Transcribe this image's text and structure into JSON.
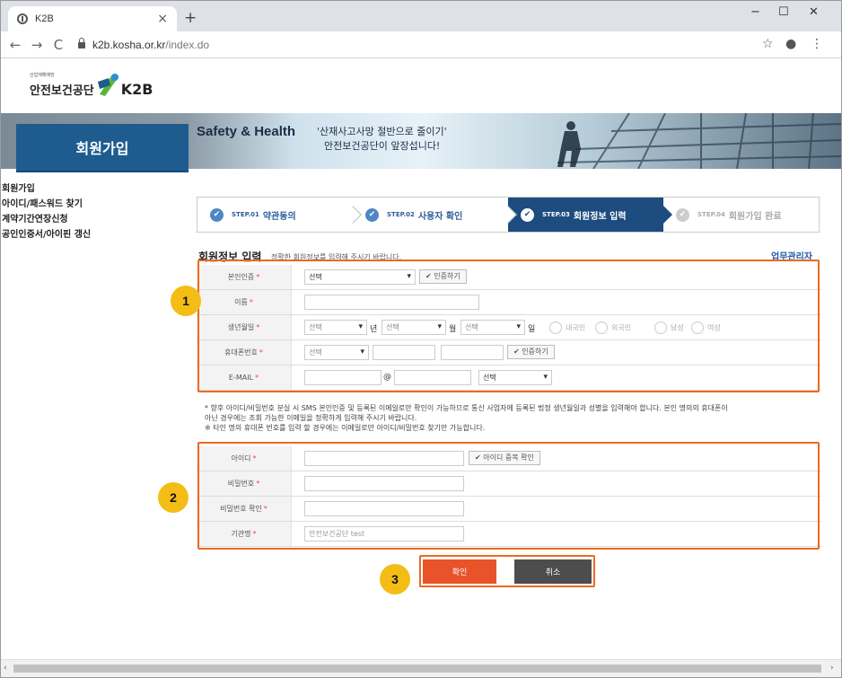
{
  "browser": {
    "tab_title": "K2B",
    "tab_close": "×",
    "new_tab": "+",
    "url_host": "k2b.kosha.or.kr",
    "url_path": "/index.do",
    "window_controls": [
      "−",
      "☐",
      "✕"
    ],
    "nav": {
      "back": "←",
      "forward": "→",
      "reload": "C"
    },
    "toolbar_icons": {
      "star": "☆",
      "account": "●",
      "menu": "⋮"
    }
  },
  "site": {
    "logo_small": "산업재해예방",
    "logo_ko": "안전보건공단",
    "logo_brand": "K2B",
    "brand_colors": {
      "blue": "#1e5c8f",
      "green": "#5db43a",
      "orange": "#ec6a1e"
    }
  },
  "hero": {
    "title": "Safety & Health",
    "message_line1": "'산재사고사망 절반으로 줄이기'",
    "message_line2": "안전보건공단이 앞장섭니다!"
  },
  "sidebar": {
    "title": "회원가입",
    "items": [
      "회원가입",
      "아이디/패스워드 찾기",
      "계약기간연장신청",
      "공인인증서/아이핀 갱신"
    ]
  },
  "steps": [
    {
      "no": "STEP.01",
      "label": "약관동의",
      "state": "done"
    },
    {
      "no": "STEP.02",
      "label": "사용자 확인",
      "state": "done"
    },
    {
      "no": "STEP.03",
      "label": "회원정보 입력",
      "state": "current"
    },
    {
      "no": "STEP.04",
      "label": "회원가입 완료",
      "state": "todo"
    }
  ],
  "section": {
    "title": "회원정보 입력",
    "subtitle": "정확한 회원정보를 입력해 주시기 바랍니다.",
    "manager_link": "업무관리자"
  },
  "form1": {
    "auth": {
      "label": "본인인증",
      "select": "선택",
      "button": "✔ 인증하기"
    },
    "name": {
      "label": "이름"
    },
    "birth": {
      "label": "생년월일",
      "year": "선택",
      "year_unit": "년",
      "month": "선택",
      "month_unit": "월",
      "day": "선택",
      "day_unit": "일",
      "radios": [
        "내국인",
        "외국인",
        "남성",
        "여성"
      ]
    },
    "phone": {
      "label": "휴대폰번호",
      "prefix": "선택",
      "button": "✔ 인증하기"
    },
    "email": {
      "label": "E-MAIL",
      "at": "@",
      "domain": "선택"
    }
  },
  "required_mark": "*",
  "notice": {
    "line1": "* 향후 아이디/비밀번호 분실 시 SMS 본인인증 및 등록된 이메일로만 확인이 가능하므로 통신 사업자에 등록된 법정 생년월일과 성별을 입력해야 합니다. 본인 명의의 휴대폰이",
    "line2": "아닌 경우에는 조회 가능한 이메일을 정확하게 입력해 주시기 바랍니다.",
    "line3": "※ 타인 명의 휴대폰 번호를 입력 할 경우에는 이메일로만 아이디/비밀번호 찾기만 가능합니다."
  },
  "form2": {
    "id": {
      "label": "아이디",
      "button": "✔ 아이디 중복 확인"
    },
    "password": {
      "label": "비밀번호"
    },
    "password_confirm": {
      "label": "비밀번호 확인"
    },
    "org": {
      "label": "기관명",
      "value": "안전보건공단 test"
    }
  },
  "badges": [
    "1",
    "2",
    "3"
  ],
  "actions": {
    "confirm": "확인",
    "cancel": "취소"
  },
  "scroll": {
    "left": "‹",
    "right": "›"
  }
}
